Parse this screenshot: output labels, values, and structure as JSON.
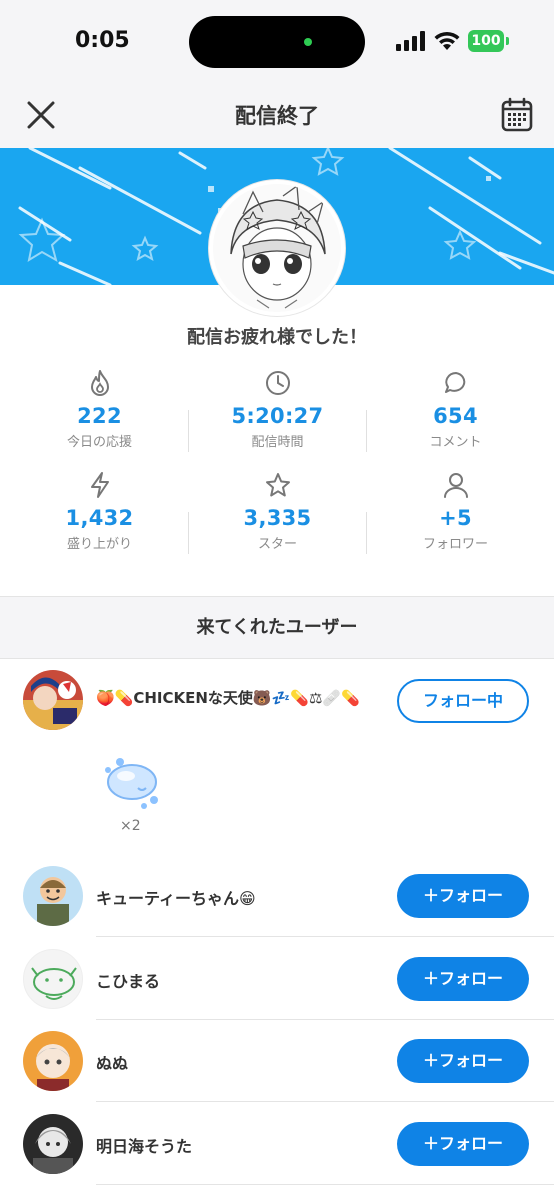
{
  "status_bar": {
    "time": "0:05",
    "battery": "100"
  },
  "nav": {
    "title": "配信終了",
    "close_icon": "close-icon",
    "calendar_icon": "calendar-icon"
  },
  "colors": {
    "accent": "#0f83e6",
    "stat_blue": "#1a8fe3",
    "banner": "#1aa6f0",
    "battery": "#34c759"
  },
  "thanks_message": "配信お疲れ様でした！",
  "stats": [
    {
      "icon": "flame-icon",
      "value": "222",
      "label": "今日の応援"
    },
    {
      "icon": "clock-icon",
      "value": "5:20:27",
      "label": "配信時間"
    },
    {
      "icon": "comment-icon",
      "value": "654",
      "label": "コメント"
    },
    {
      "icon": "lightning-icon",
      "value": "1,432",
      "label": "盛り上がり"
    },
    {
      "icon": "star-icon",
      "value": "3,335",
      "label": "スター"
    },
    {
      "icon": "person-icon",
      "value": "+5",
      "label": "フォロワー"
    }
  ],
  "section_title": "来てくれたユーザー",
  "users": [
    {
      "name": "🍑💊CHICKENな天使🐻💤💊⚖🩹💊",
      "button": "フォロー中",
      "following": true,
      "gift_count": "×2"
    },
    {
      "name": "キューティーちゃん😁",
      "button": "＋フォロー",
      "following": false
    },
    {
      "name": "こひまる",
      "button": "＋フォロー",
      "following": false
    },
    {
      "name": "ぬぬ",
      "button": "＋フォロー",
      "following": false
    },
    {
      "name": "明日海そうた",
      "button": "＋フォロー",
      "following": false
    }
  ]
}
